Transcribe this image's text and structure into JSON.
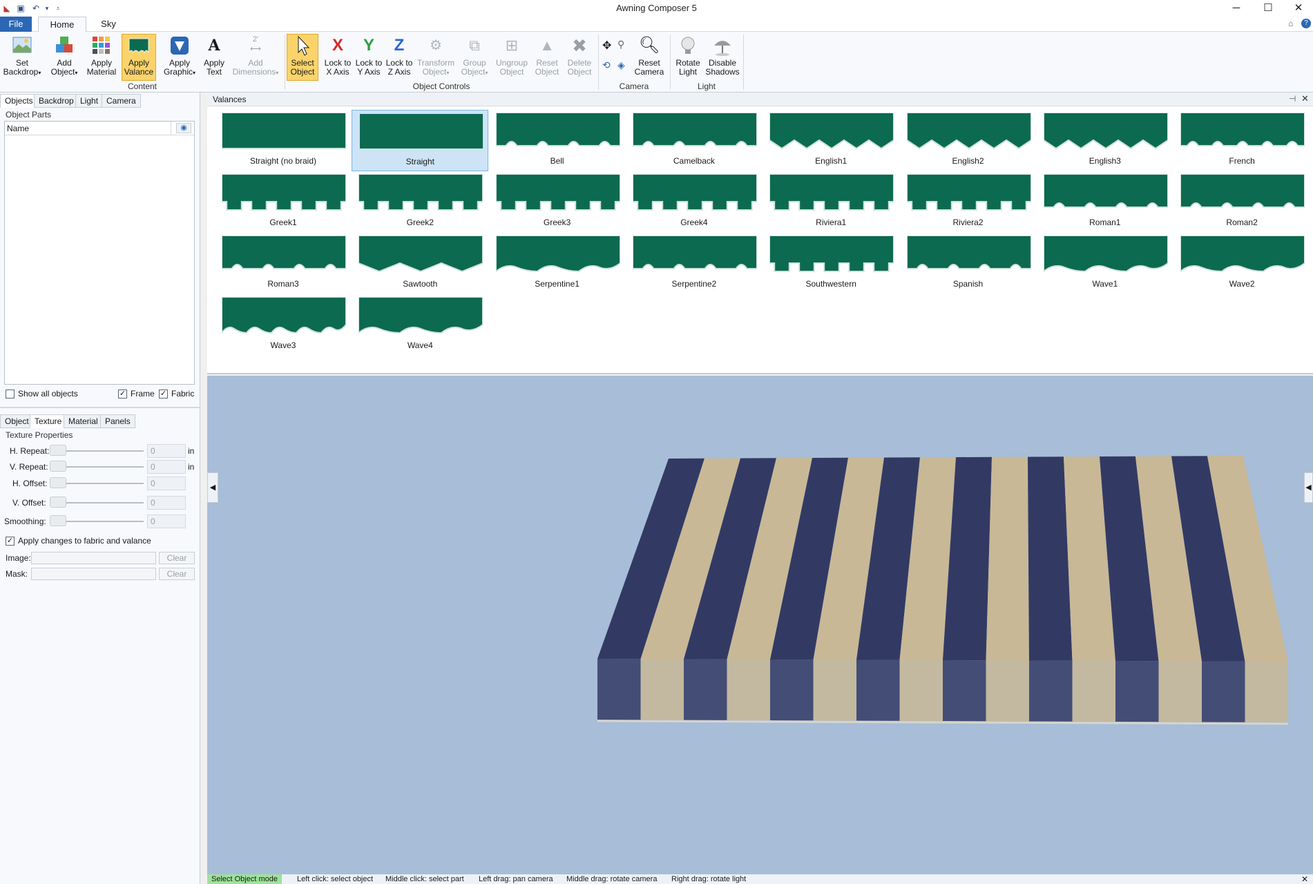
{
  "window": {
    "title": "Awning Composer 5"
  },
  "ribbon_tabs": {
    "file": "File",
    "home": "Home",
    "sky": "Sky"
  },
  "ribbon": {
    "set_backdrop": "Set\nBackdrop",
    "add_object": "Add\nObject",
    "apply_material": "Apply\nMaterial",
    "apply_valance": "Apply\nValance",
    "apply_graphic": "Apply\nGraphic",
    "apply_text": "Apply\nText",
    "add_dimensions": "Add\nDimensions",
    "select_object": "Select\nObject",
    "lock_x": "Lock to\nX Axis",
    "lock_y": "Lock to\nY Axis",
    "lock_z": "Lock to\nZ Axis",
    "transform_object": "Transform\nObject",
    "group_object": "Group\nObject",
    "ungroup_object": "Ungroup\nObject",
    "reset_object": "Reset\nObject",
    "delete_object": "Delete\nObject",
    "reset_camera": "Reset\nCamera",
    "rotate_light": "Rotate\nLight",
    "disable_shadows": "Disable\nShadows",
    "groups": {
      "content": "Content",
      "object_controls": "Object Controls",
      "camera": "Camera",
      "light": "Light"
    },
    "axis_letters": {
      "x": "X",
      "y": "Y",
      "z": "Z"
    },
    "dimension_glyph": "2'",
    "text_glyph": "A"
  },
  "left_panel": {
    "tabs": [
      "Objects",
      "Backdrop",
      "Light",
      "Camera"
    ],
    "object_parts_title": "Object Parts",
    "name_column": "Name",
    "show_all_objects": "Show all objects",
    "frame": "Frame",
    "fabric": "Fabric",
    "frame_checked": true,
    "fabric_checked": true,
    "show_all_checked": false,
    "bottom_tabs": [
      "Object",
      "Texture",
      "Material",
      "Panels"
    ],
    "texture_title": "Texture Properties",
    "h_repeat": "H. Repeat:",
    "v_repeat": "V. Repeat:",
    "h_offset": "H. Offset:",
    "v_offset": "V. Offset:",
    "smoothing": "Smoothing:",
    "unit_in": "in",
    "values": {
      "h_repeat": "0",
      "v_repeat": "0",
      "h_offset": "0",
      "v_offset": "0",
      "smoothing": "0"
    },
    "apply_changes": "Apply changes to fabric and valance",
    "apply_changes_checked": true,
    "image": "Image:",
    "mask": "Mask:",
    "clear": "Clear"
  },
  "valances": {
    "title": "Valances",
    "selected": "Straight",
    "items": [
      "Straight (no braid)",
      "Straight",
      "Bell",
      "Camelback",
      "English1",
      "English2",
      "English3",
      "French",
      "Greek1",
      "Greek2",
      "Greek3",
      "Greek4",
      "Riviera1",
      "Riviera2",
      "Roman1",
      "Roman2",
      "Roman3",
      "Sawtooth",
      "Serpentine1",
      "Serpentine2",
      "Southwestern",
      "Spanish",
      "Wave1",
      "Wave2",
      "Wave3",
      "Wave4"
    ]
  },
  "colors": {
    "valance_green": "#0c6a50",
    "valance_green_light": "#14866a",
    "stripe_navy": "#323a64",
    "stripe_tan": "#c8b896",
    "viewport_bg": "#a7bdd8"
  },
  "statusbar": {
    "mode": "Select Object mode",
    "items": [
      "Left click: select object",
      "Middle click: select part",
      "Left drag: pan camera",
      "Middle drag: rotate camera",
      "Right drag: rotate light"
    ]
  }
}
